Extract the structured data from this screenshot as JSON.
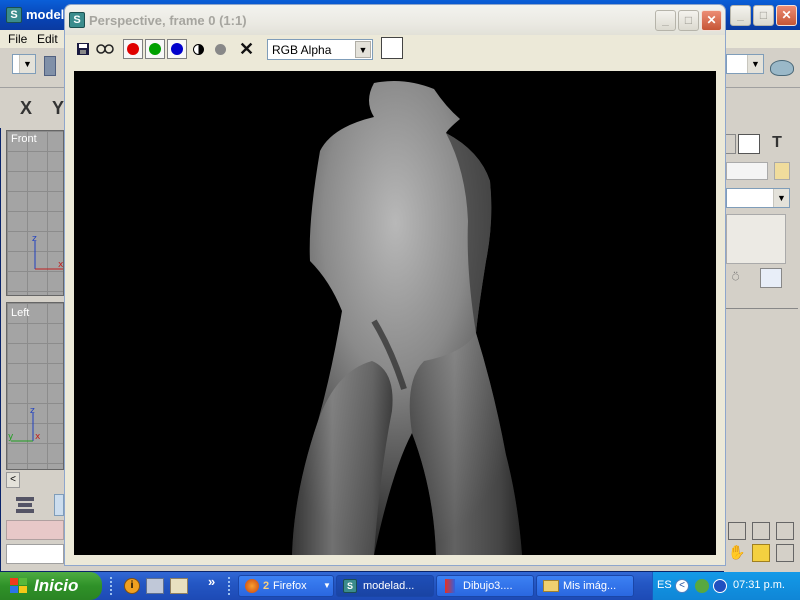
{
  "background_window": {
    "title": "model",
    "menu": [
      "File",
      "Edit"
    ],
    "viewports": [
      {
        "label": "Front"
      },
      {
        "label": "Left"
      }
    ],
    "axis_labels": {
      "z": "z",
      "x": "x",
      "y": "y"
    }
  },
  "render_window": {
    "title": "Perspective, frame 0 (1:1)",
    "channel": "RGB Alpha",
    "toolbar": {
      "save_icon": "save-icon",
      "clone_icon": "clone-icon",
      "red_channel": "#e00000",
      "green_channel": "#00a000",
      "blue_channel": "#0000cc",
      "clear_label": "✕"
    }
  },
  "taskbar": {
    "start_label": "Inicio",
    "chevron": "»",
    "tasks": [
      {
        "label": "2 Firefox",
        "count": "2",
        "name": "Firefox"
      },
      {
        "label": "modelad...",
        "active": true
      },
      {
        "label": "Dibujo3...."
      },
      {
        "label": "Mis imág..."
      }
    ],
    "language": "ES",
    "clock": "07:31 p.m."
  },
  "colors": {
    "xp_blue": "#0a5fd8",
    "start_green": "#2f9128",
    "render_bg": "#000000"
  }
}
